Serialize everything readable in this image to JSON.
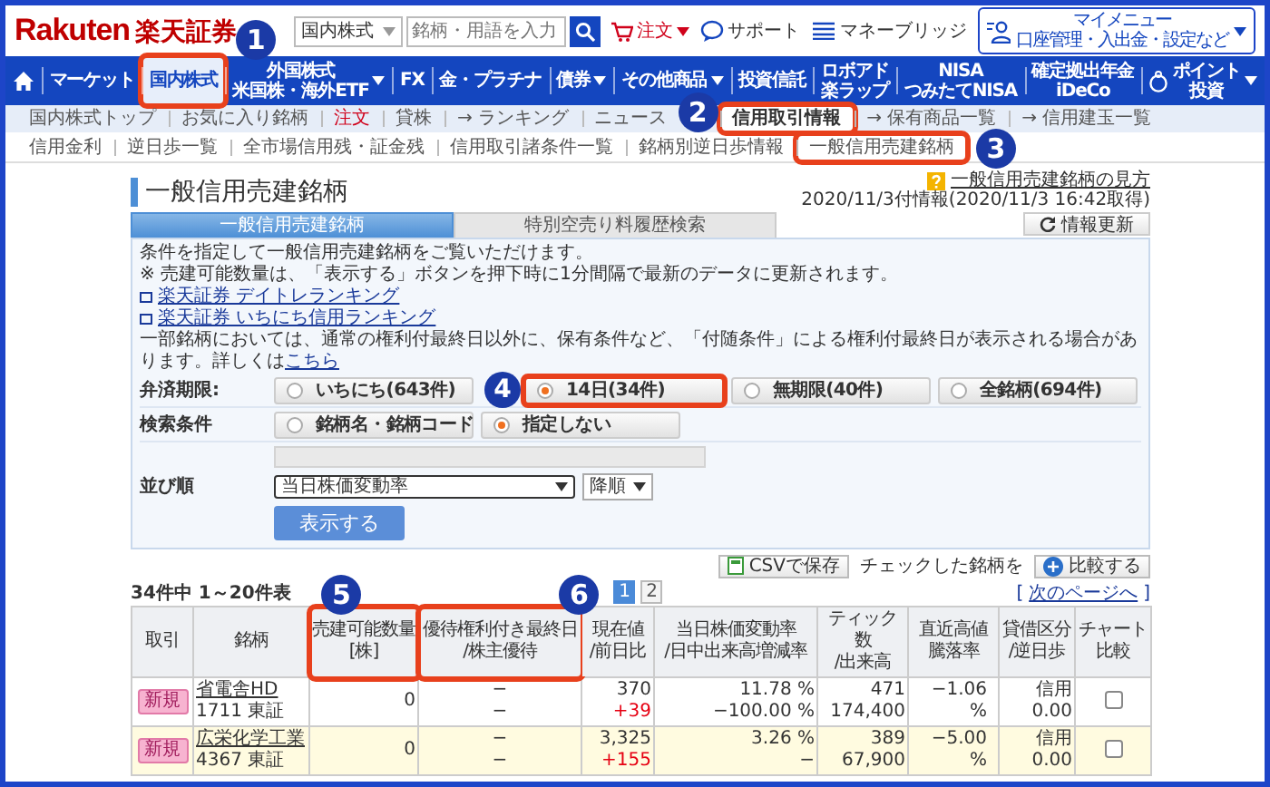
{
  "header": {
    "logo_brand": "Rakuten",
    "logo_name": "楽天証券",
    "search_scope": "国内株式",
    "search": {
      "placeholder": "銘柄・用語を入力"
    },
    "links": [
      {
        "kind": "order",
        "label": "注文"
      },
      {
        "kind": "support",
        "label": "サポート"
      },
      {
        "kind": "bridge",
        "label": "マネーブリッジ"
      }
    ],
    "my_menu": {
      "title": "マイメニュー",
      "subtitle": "口座管理・入出金・設定など"
    }
  },
  "main_nav": [
    {
      "kind": "home",
      "selected": false,
      "dropdown": false
    },
    {
      "kind": "text",
      "label": "マーケット",
      "selected": false,
      "dropdown": false
    },
    {
      "kind": "text",
      "label": "国内株式",
      "selected": true,
      "dropdown": false,
      "callout": "1"
    },
    {
      "kind": "text",
      "label": "外国株式",
      "sublabel": "米国株・海外ETF",
      "selected": false,
      "dropdown": true
    },
    {
      "kind": "text",
      "label": "FX",
      "selected": false,
      "dropdown": false
    },
    {
      "kind": "text",
      "label": "金・プラチナ",
      "selected": false,
      "dropdown": false
    },
    {
      "kind": "text",
      "label": "債券",
      "selected": false,
      "dropdown": true
    },
    {
      "kind": "text",
      "label": "その他商品",
      "selected": false,
      "dropdown": true
    },
    {
      "kind": "text",
      "label": "投資信託",
      "selected": false,
      "dropdown": false
    },
    {
      "kind": "text",
      "label": "ロボアド",
      "sublabel": "楽ラップ",
      "selected": false,
      "dropdown": false
    },
    {
      "kind": "text",
      "label": "NISA",
      "sublabel": "つみたてNISA",
      "selected": false,
      "dropdown": false
    },
    {
      "kind": "text",
      "label": "確定拠出年金",
      "sublabel": "iDeCo",
      "selected": false,
      "dropdown": false
    },
    {
      "kind": "point",
      "label": "ポイント",
      "sublabel": "投資",
      "selected": false,
      "dropdown": true
    }
  ],
  "sub_nav": [
    {
      "label": "国内株式トップ",
      "selected": false,
      "alert": false
    },
    {
      "label": "お気に入り銘柄",
      "selected": false,
      "alert": false
    },
    {
      "label": "注文",
      "selected": false,
      "alert": true
    },
    {
      "label": "貸株",
      "selected": false,
      "alert": false
    },
    {
      "label": "→ ランキング",
      "selected": false,
      "alert": false
    },
    {
      "label": "ニュース",
      "selected": false,
      "alert": false
    },
    {
      "label": "信用取引情報",
      "selected": true,
      "alert": false,
      "callout": "2"
    },
    {
      "label": "→ 保有商品一覧",
      "selected": false,
      "alert": false
    },
    {
      "label": "→ 信用建玉一覧",
      "selected": false,
      "alert": false
    }
  ],
  "sub_sub_nav": [
    {
      "label": "信用金利"
    },
    {
      "label": "逆日歩一覧"
    },
    {
      "label": "全市場信用残・証金残"
    },
    {
      "label": "信用取引諸条件一覧"
    },
    {
      "label": "銘柄別逆日歩情報"
    },
    {
      "label": "一般信用売建銘柄",
      "callout": "3"
    }
  ],
  "page": {
    "title": "一般信用売建銘柄",
    "help_link": "一般信用売建銘柄の見方",
    "as_of": "2020/11/3付情報(2020/11/3 16:42取得)",
    "tabs": [
      {
        "label": "一般信用売建銘柄",
        "selected": true
      },
      {
        "label": "特別空売り料履歴検索",
        "selected": false
      }
    ],
    "refresh_button": "情報更新"
  },
  "panel": {
    "intro": "条件を指定して一般信用売建銘柄をご覧いただけます。",
    "note": "※ 売建可能数量は、「表示する」ボタンを押下時に1分間隔で最新のデータに更新されます。",
    "links": [
      "楽天証券 デイトレランキング",
      "楽天証券 いちにち信用ランキング"
    ],
    "notice": "一部銘柄においては、通常の権利付最終日以外に、保有条件など、「付随条件」による権利付最終日が表示される場合があります。詳しくは",
    "notice_link": "こちら",
    "filters": [
      {
        "label": "弁済期限:",
        "options": [
          {
            "label": "いちにち(643件)",
            "selected": false
          },
          {
            "label": "14日(34件)",
            "selected": true,
            "callout": "4"
          },
          {
            "label": "無期限(40件)",
            "selected": false
          },
          {
            "label": "全銘柄(694件)",
            "selected": false
          }
        ]
      },
      {
        "label": "検索条件",
        "options": [
          {
            "label": "銘柄名・銘柄コード",
            "selected": false
          },
          {
            "label": "指定しない",
            "selected": true
          }
        ]
      }
    ],
    "sort": {
      "label": "並び順",
      "field": "当日株価変動率",
      "order": "降順"
    },
    "submit": "表示する"
  },
  "results": {
    "csv_button": "CSVで保存",
    "compare_label": "チェックした銘柄を",
    "compare_button": "比較する",
    "count": "34件中 1～20件表",
    "pages": [
      {
        "label": "1",
        "selected": true
      },
      {
        "label": "2",
        "selected": false
      }
    ],
    "next_prefix": "[",
    "next_link": "次のページへ",
    "next_suffix": "]",
    "columns": [
      {
        "label": "取引"
      },
      {
        "label": "銘柄"
      },
      {
        "label": "売建可能数量",
        "sub": "[株]",
        "callout": "5"
      },
      {
        "label": "優待権利付き最終日",
        "sub": "/株主優待",
        "callout": "6"
      },
      {
        "label": "現在値",
        "sub": "/前日比"
      },
      {
        "label": "当日株価変動率",
        "sub": "/日中出来高増減率"
      },
      {
        "label": "ティック数",
        "sub": "/出来高"
      },
      {
        "label": "直近高値",
        "sub": "騰落率"
      },
      {
        "label": "貸借区分",
        "sub": "/逆日歩"
      },
      {
        "label": "チャート",
        "sub": "比較"
      }
    ],
    "rows": [
      {
        "trade": "新規",
        "name": "省電舎HD",
        "code": "1711 東証",
        "short_qty": "0",
        "benefit_date": "−",
        "benefit": "−",
        "price": "370",
        "change": "+39",
        "rising": true,
        "change_rate": "11.78 %",
        "volume_rate": "−100.00 %",
        "ticks": "471",
        "volume": "174,400",
        "from_high": "−1.06 %",
        "lending": "信用",
        "reverse_fee": "0.00",
        "checked": false,
        "highlighted": false
      },
      {
        "trade": "新規",
        "name": "広栄化学工業",
        "code": "4367 東証",
        "short_qty": "0",
        "benefit_date": "−",
        "benefit": "−",
        "price": "3,325",
        "change": "+155",
        "rising": true,
        "change_rate": "3.26 %",
        "volume_rate": "−",
        "ticks": "389",
        "volume": "67,900",
        "from_high": "−5.00 %",
        "lending": "信用",
        "reverse_fee": "0.00",
        "checked": false,
        "highlighted": true
      }
    ]
  }
}
